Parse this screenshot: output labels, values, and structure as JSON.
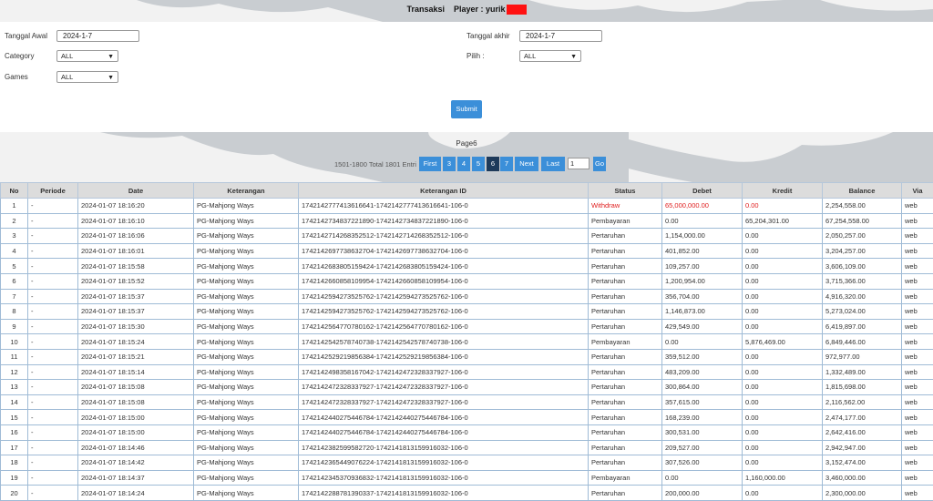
{
  "header": {
    "title": "Transaksi",
    "player_label": "Player : yurik"
  },
  "filters": {
    "start_label": "Tanggal Awal",
    "start_value": "2024-1-7",
    "end_label": "Tanggal akhir",
    "end_value": "2024-1-7",
    "category_label": "Category",
    "category_value": "ALL",
    "pilih_label": "Pilih  :",
    "pilih_value": "ALL",
    "games_label": "Games",
    "games_value": "ALL",
    "submit_label": "Submit"
  },
  "pagination": {
    "page_label": "Page6",
    "entries_text": "1501-1800 Total 1801 Entri",
    "first": "First",
    "prev_pages": [
      "3",
      "4",
      "5"
    ],
    "current": "6",
    "next_page": "7",
    "next": "Next",
    "last": "Last",
    "jump_value": "1",
    "go": "Go"
  },
  "table": {
    "headers": [
      "No",
      "Periode",
      "Date",
      "Keterangan",
      "Keterangan ID",
      "Status",
      "Debet",
      "Kredit",
      "Balance",
      "Via"
    ],
    "rows": [
      [
        "1",
        "-",
        "2024-01-07 18:16:20",
        "PG-Mahjong Ways",
        "1742142777413616641-1742142777413616641-106-0",
        "Withdraw",
        "65,000,000.00",
        "0.00",
        "2,254,558.00",
        "web"
      ],
      [
        "2",
        "-",
        "2024-01-07 18:16:10",
        "PG-Mahjong Ways",
        "1742142734837221890-1742142734837221890-106-0",
        "Pembayaran",
        "0.00",
        "65,204,301.00",
        "67,254,558.00",
        "web"
      ],
      [
        "3",
        "-",
        "2024-01-07 18:16:06",
        "PG-Mahjong Ways",
        "1742142714268352512-1742142714268352512-106-0",
        "Pertaruhan",
        "1,154,000.00",
        "0.00",
        "2,050,257.00",
        "web"
      ],
      [
        "4",
        "-",
        "2024-01-07 18:16:01",
        "PG-Mahjong Ways",
        "1742142697738632704-1742142697738632704-106-0",
        "Pertaruhan",
        "401,852.00",
        "0.00",
        "3,204,257.00",
        "web"
      ],
      [
        "5",
        "-",
        "2024-01-07 18:15:58",
        "PG-Mahjong Ways",
        "1742142683805159424-1742142683805159424-106-0",
        "Pertaruhan",
        "109,257.00",
        "0.00",
        "3,606,109.00",
        "web"
      ],
      [
        "6",
        "-",
        "2024-01-07 18:15:52",
        "PG-Mahjong Ways",
        "1742142660858109954-1742142660858109954-106-0",
        "Pertaruhan",
        "1,200,954.00",
        "0.00",
        "3,715,366.00",
        "web"
      ],
      [
        "7",
        "-",
        "2024-01-07 18:15:37",
        "PG-Mahjong Ways",
        "1742142594273525762-1742142594273525762-106-0",
        "Pertaruhan",
        "356,704.00",
        "0.00",
        "4,916,320.00",
        "web"
      ],
      [
        "8",
        "-",
        "2024-01-07 18:15:37",
        "PG-Mahjong Ways",
        "1742142594273525762-1742142594273525762-106-0",
        "Pertaruhan",
        "1,146,873.00",
        "0.00",
        "5,273,024.00",
        "web"
      ],
      [
        "9",
        "-",
        "2024-01-07 18:15:30",
        "PG-Mahjong Ways",
        "1742142564770780162-1742142564770780162-106-0",
        "Pertaruhan",
        "429,549.00",
        "0.00",
        "6,419,897.00",
        "web"
      ],
      [
        "10",
        "-",
        "2024-01-07 18:15:24",
        "PG-Mahjong Ways",
        "1742142542578740738-1742142542578740738-106-0",
        "Pembayaran",
        "0.00",
        "5,876,469.00",
        "6,849,446.00",
        "web"
      ],
      [
        "11",
        "-",
        "2024-01-07 18:15:21",
        "PG-Mahjong Ways",
        "1742142529219856384-1742142529219856384-106-0",
        "Pertaruhan",
        "359,512.00",
        "0.00",
        "972,977.00",
        "web"
      ],
      [
        "12",
        "-",
        "2024-01-07 18:15:14",
        "PG-Mahjong Ways",
        "1742142498358167042-1742142472328337927-106-0",
        "Pertaruhan",
        "483,209.00",
        "0.00",
        "1,332,489.00",
        "web"
      ],
      [
        "13",
        "-",
        "2024-01-07 18:15:08",
        "PG-Mahjong Ways",
        "1742142472328337927-1742142472328337927-106-0",
        "Pertaruhan",
        "300,864.00",
        "0.00",
        "1,815,698.00",
        "web"
      ],
      [
        "14",
        "-",
        "2024-01-07 18:15:08",
        "PG-Mahjong Ways",
        "1742142472328337927-1742142472328337927-106-0",
        "Pertaruhan",
        "357,615.00",
        "0.00",
        "2,116,562.00",
        "web"
      ],
      [
        "15",
        "-",
        "2024-01-07 18:15:00",
        "PG-Mahjong Ways",
        "1742142440275446784-1742142440275446784-106-0",
        "Pertaruhan",
        "168,239.00",
        "0.00",
        "2,474,177.00",
        "web"
      ],
      [
        "16",
        "-",
        "2024-01-07 18:15:00",
        "PG-Mahjong Ways",
        "1742142440275446784-1742142440275446784-106-0",
        "Pertaruhan",
        "300,531.00",
        "0.00",
        "2,642,416.00",
        "web"
      ],
      [
        "17",
        "-",
        "2024-01-07 18:14:46",
        "PG-Mahjong Ways",
        "1742142382599582720-1742141813159916032-106-0",
        "Pertaruhan",
        "209,527.00",
        "0.00",
        "2,942,947.00",
        "web"
      ],
      [
        "18",
        "-",
        "2024-01-07 18:14:42",
        "PG-Mahjong Ways",
        "1742142365449076224-1742141813159916032-106-0",
        "Pertaruhan",
        "307,526.00",
        "0.00",
        "3,152,474.00",
        "web"
      ],
      [
        "19",
        "-",
        "2024-01-07 18:14:37",
        "PG-Mahjong Ways",
        "1742142345370936832-1742141813159916032-106-0",
        "Pembayaran",
        "0.00",
        "1,160,000.00",
        "3,460,000.00",
        "web"
      ],
      [
        "20",
        "-",
        "2024-01-07 18:14:24",
        "PG-Mahjong Ways",
        "1742142288781390337-1742141813159916032-106-0",
        "Pertaruhan",
        "200,000.00",
        "0.00",
        "2,300,000.00",
        "web"
      ]
    ]
  }
}
